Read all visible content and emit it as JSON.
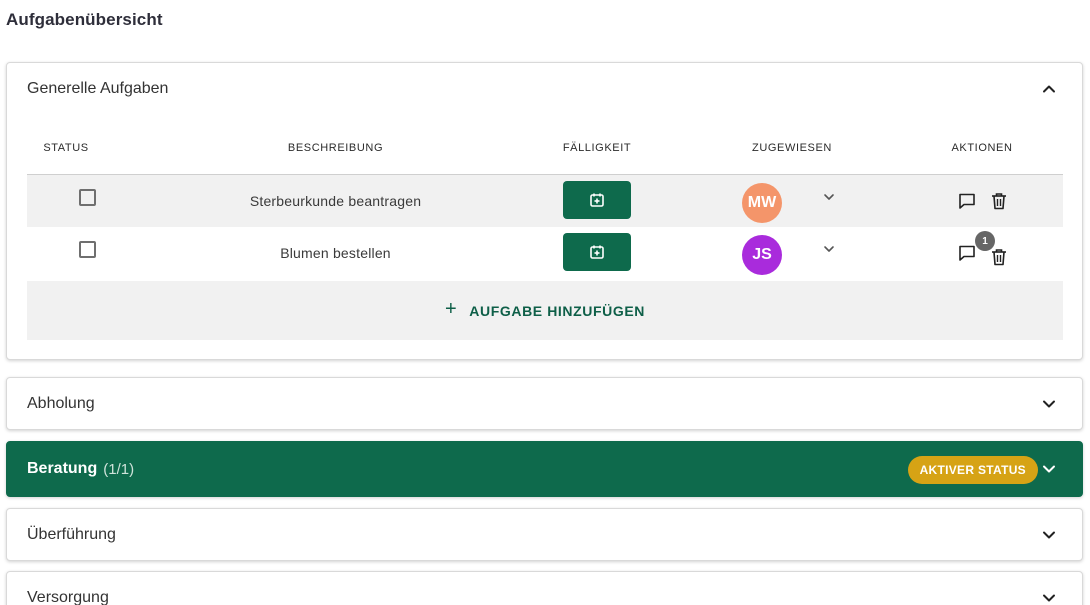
{
  "page": {
    "title": "Aufgabenübersicht"
  },
  "general": {
    "title": "Generelle Aufgaben",
    "columns": {
      "status": "STATUS",
      "description": "BESCHREIBUNG",
      "due": "FÄLLIGKEIT",
      "assigned": "ZUGEWIESEN",
      "actions": "AKTIONEN"
    },
    "tasks": [
      {
        "description": "Sterbeurkunde beantragen",
        "assignee_initials": "MW",
        "avatar_color": "#f4956a",
        "comment_count": ""
      },
      {
        "description": "Blumen bestellen",
        "assignee_initials": "JS",
        "avatar_color": "#a92bdc",
        "comment_count": "1"
      }
    ],
    "add_task_label": "AUFGABE HINZUFÜGEN"
  },
  "sections": {
    "abholung": {
      "title": "Abholung"
    },
    "beratung": {
      "title": "Beratung",
      "count": "(1/1)",
      "status_label": "AKTIVER STATUS"
    },
    "ueberfuehrung": {
      "title": "Überführung"
    },
    "versorgung": {
      "title": "Versorgung"
    }
  },
  "colors": {
    "primary": "#0e6a4c",
    "status_badge": "#d6a315"
  },
  "icons": {
    "expand": "chevron-up-icon",
    "collapse": "chevron-down-icon",
    "date": "calendar-plus-icon",
    "comment": "comment-icon",
    "delete": "trash-icon",
    "add": "plus-icon"
  }
}
